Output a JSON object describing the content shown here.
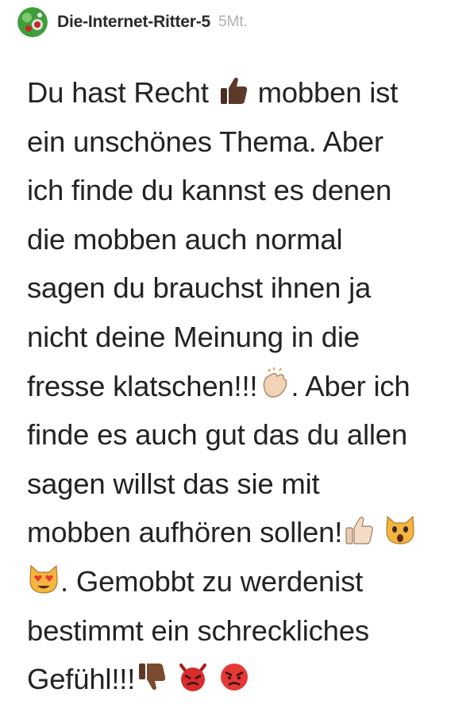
{
  "comment": {
    "author": "Die-Internet-Ritter-5",
    "timestamp": "5Mt.",
    "lines": [
      "Du hast Recht",
      "mobben ist",
      "ein unschönes Thema. Aber",
      "ich finde du kannst es denen",
      "die mobben auch normal",
      "sagen du brauchst ihnen ja",
      "nicht deine Meinung in die",
      "fresse klatschen!!!",
      ". Aber ich",
      "finde es auch gut das du allen",
      "sagen willst das sie mit",
      "mobben aufhören sollen!",
      ". Gemobbt zu werdenist",
      "bestimmt ein schreckliches",
      "Gefühl!!!"
    ],
    "emojis": {
      "thumbs_up_dark": "thumbs-up-dark-skin-icon",
      "clapping": "clapping-hands-icon",
      "thumbs_up_light": "thumbs-up-light-skin-icon",
      "screaming_cat": "weary-cat-icon",
      "heart_eyes_cat": "heart-eyes-cat-icon",
      "thumbs_down": "thumbs-down-icon",
      "angry_devil": "angry-devil-icon",
      "angry_face": "angry-face-icon"
    }
  }
}
